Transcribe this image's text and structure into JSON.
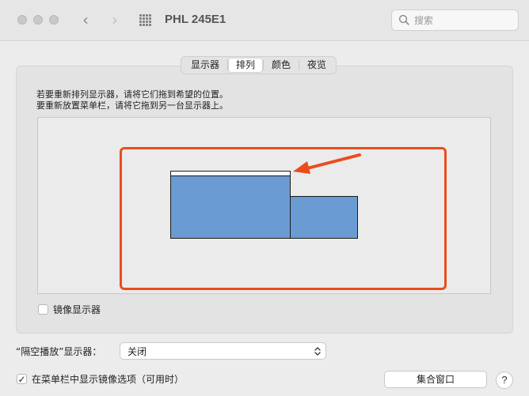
{
  "window": {
    "title": "PHL 245E1"
  },
  "toolbar": {
    "search_placeholder": "搜索",
    "icons": {
      "back": "chevron-left-icon",
      "forward": "chevron-right-icon",
      "show_all": "grid-icon",
      "search": "search-icon"
    }
  },
  "tabs": [
    {
      "label": "显示器",
      "active": false
    },
    {
      "label": "排列",
      "active": true
    },
    {
      "label": "颜色",
      "active": false
    },
    {
      "label": "夜览",
      "active": false
    }
  ],
  "instructions": {
    "line1": "若要重新排列显示器，请将它们拖到希望的位置。",
    "line2": "要重新放置菜单栏，请将它拖到另一台显示器上。"
  },
  "arrangement": {
    "highlight_color": "#ea4c1d",
    "display_color": "#6b9bd3",
    "annotation_color": "#ea4c1d",
    "main_display_has_menu_bar": true,
    "display_count": 2
  },
  "mirror_displays": {
    "label": "镜像显示器",
    "checked": false
  },
  "airplay": {
    "label": "“隔空播放”显示器：",
    "value": "关闭"
  },
  "show_mirroring_options": {
    "label": "在菜单栏中显示镜像选项（可用时）",
    "checked": true
  },
  "buttons": {
    "gather_windows": "集合窗口",
    "help": "?"
  }
}
